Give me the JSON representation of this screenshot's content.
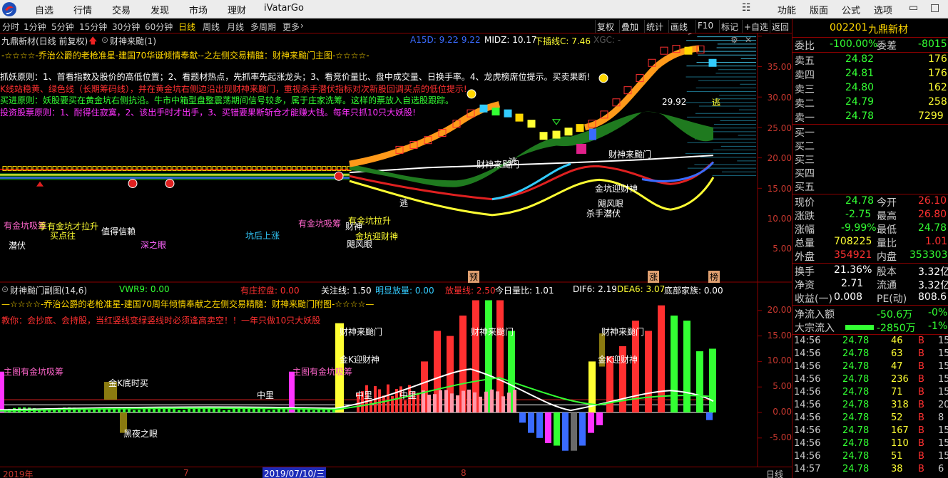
{
  "menu": {
    "items": [
      "自选",
      "行情",
      "交易",
      "发现",
      "市场",
      "理财",
      "iVatarGo"
    ],
    "right": [
      "功能",
      "版面",
      "公式",
      "选项"
    ]
  },
  "periods": [
    "分时",
    "1分钟",
    "5分钟",
    "15分钟",
    "30分钟",
    "60分钟",
    "日线",
    "周线",
    "月线",
    "多周期",
    "更多"
  ],
  "active_period": "日线",
  "tools": [
    "复权",
    "叠加",
    "统计",
    "画线",
    "F10",
    "标记",
    "+自选",
    "返回"
  ],
  "main": {
    "title": "九鼎新材(日线 前复权)",
    "indicator": "财神来颱(1)",
    "values": [
      {
        "t": "A15D: 9.22",
        "c": "#3a6bff"
      },
      {
        "t": ": 9.22",
        "c": "#3a6bff"
      },
      {
        "t": "MIDZ: 10.17",
        "c": "#ffffff"
      },
      {
        "t": "下插线C: 7.46",
        "c": "#ffff33"
      },
      {
        "t": "XGC: -",
        "c": "#555"
      }
    ],
    "banner": "-☆☆☆☆-乔治公爵的老枪准星-建国70华诞倾情奉献--之左侧交易精髓：财神来颱门主图-☆☆☆☆-",
    "desc": [
      {
        "t": "抓妖原则：1、首看指数及股价的高低位置；2、看题材热点，先抓率先起涨龙头；3、看竞价量比、盘中成交量、日换手率。4、龙虎榜席位提示。买卖果断!",
        "c": "#ffffff"
      },
      {
        "t": "K线站稳黄、绿色线（长期筹码线），并在黄金坑右侧边沿出现财神来颱门，重视杀手潜伏指标对次新股回调买点的低位提示!",
        "c": "#ff3030"
      },
      {
        "t": "买进原则：妖股要买在黄金坑右侧抗沿。牛市中箱型盘整震荡期间信号较多，属于庄家洗筹。这样的票放入自选股跟踪。",
        "c": "#33ff33"
      },
      {
        "t": "投资股票原则：1、耐得住寂寞，2、该出手时才出手，3、买错要果断斩仓才能赚大钱。每年只抓10只大妖股!",
        "c": "#ff33ff"
      }
    ],
    "price_ticks": [
      "35.00",
      "30.00",
      "25.00",
      "20.00",
      "15.00",
      "10.00",
      "5.00"
    ],
    "labels": [
      {
        "t": "有金坑吸筹",
        "c": "#ff66cc"
      },
      {
        "t": "季有金坑才拉升",
        "c": "#ffff33"
      },
      {
        "t": "买点往",
        "c": "#ffff33"
      },
      {
        "t": "值得信赖",
        "c": "#ffffff"
      },
      {
        "t": "潜伏",
        "c": "#ffffff"
      },
      {
        "t": "深之眼",
        "c": "#ff66ff"
      },
      {
        "t": "坑后上涨",
        "c": "#33ccff"
      },
      {
        "t": "有金坑吸筹",
        "c": "#ff66cc"
      },
      {
        "t": "有金坑拉升",
        "c": "#ffff33"
      },
      {
        "t": "财神",
        "c": "#ffffff"
      },
      {
        "t": "金坑迎财神",
        "c": "#ffff33"
      },
      {
        "t": "飓风眼",
        "c": "#ffffff"
      },
      {
        "t": "逃",
        "c": "#ffffff"
      },
      {
        "t": "财神来颱门",
        "c": "#ffffff"
      },
      {
        "t": "逃",
        "c": "#ffffff"
      },
      {
        "t": "财神来颱门",
        "c": "#ffffff"
      },
      {
        "t": "金坑迎财神",
        "c": "#ffffff"
      },
      {
        "t": "飓风眼",
        "c": "#ffffff"
      },
      {
        "t": "杀手潜伏",
        "c": "#ffffff"
      },
      {
        "t": "29.92",
        "c": "#ffffff"
      },
      {
        "t": "逃",
        "c": "#ffff33"
      },
      {
        "t": "预",
        "c": "#000000"
      },
      {
        "t": "涨",
        "c": "#000000"
      },
      {
        "t": "榜",
        "c": "#000000"
      }
    ]
  },
  "sub": {
    "title": "财神颱门副图(14,6)",
    "values": [
      {
        "t": "VWR9: 0.00",
        "c": "#33ff33"
      },
      {
        "t": "有庄控盘: 0.00",
        "c": "#ff3030"
      },
      {
        "t": "关注线: 1.50",
        "c": "#ffffff"
      },
      {
        "t": "明显放量: 0.00",
        "c": "#33ccff"
      },
      {
        "t": "放量线: 2.50",
        "c": "#ff3030"
      },
      {
        "t": "今日量比: 1.01",
        "c": "#ffffff"
      },
      {
        "t": "DIF6: 2.19",
        "c": "#ffffff"
      },
      {
        "t": "DEA6: 3.07",
        "c": "#ffff33"
      },
      {
        "t": "底部家族: 0.00",
        "c": "#ffffff"
      }
    ],
    "banner": "—☆☆☆☆-乔治公爵的老枪准星-建国70周年倾情奉献之左侧交易精髓：财神来颱门附图-☆☆☆☆—",
    "teach": "教你：会抄底、会持股，当红竖线变绿竖线时必须逢高卖空！！一年只做10只大妖股",
    "ticks": [
      "20.00",
      "15.00",
      "10.00",
      "5.00",
      "0.00",
      "-5.00"
    ],
    "labels": [
      {
        "t": "主图有金坑吸筹",
        "c": "#ff66cc"
      },
      {
        "t": "金K底时买",
        "c": "#ffffff"
      },
      {
        "t": "黑夜之眼",
        "c": "#ffffff"
      },
      {
        "t": "中里",
        "c": "#ffffff"
      },
      {
        "t": "主图有金坑吸筹",
        "c": "#ff66cc"
      },
      {
        "t": "财神来颱门",
        "c": "#ffffff"
      },
      {
        "t": "金K迎财神",
        "c": "#ffffff"
      },
      {
        "t": "中里",
        "c": "#ffffff"
      },
      {
        "t": "中里",
        "c": "#ffffff"
      },
      {
        "t": "财神来颱门",
        "c": "#ffffff"
      },
      {
        "t": "财神来颱门",
        "c": "#ffffff"
      },
      {
        "t": "金K迎财神",
        "c": "#ffffff"
      }
    ]
  },
  "dates": [
    {
      "t": "2019年",
      "hl": false
    },
    {
      "t": "7",
      "hl": false
    },
    {
      "t": "2019/07/10/三",
      "hl": true
    },
    {
      "t": "8",
      "hl": false
    }
  ],
  "corner_label": "日线",
  "stock": {
    "code": "002201",
    "name": "九鼎新材"
  },
  "order_book": [
    {
      "l": "委比",
      "v": "-100.00%",
      "c": "#33ff33",
      "l2": "委差",
      "v2": "-8015",
      "c2": "#33ff33"
    },
    {
      "l": "卖五",
      "v": "24.82",
      "c": "#33ff33",
      "q": "176"
    },
    {
      "l": "卖四",
      "v": "24.81",
      "c": "#33ff33",
      "q": "176"
    },
    {
      "l": "卖三",
      "v": "24.80",
      "c": "#33ff33",
      "q": "162"
    },
    {
      "l": "卖二",
      "v": "24.79",
      "c": "#33ff33",
      "q": "258"
    },
    {
      "l": "卖一",
      "v": "24.78",
      "c": "#33ff33",
      "q": "7299"
    },
    {
      "l": "买一",
      "v": "",
      "c": "#ccc",
      "q": ""
    },
    {
      "l": "买二",
      "v": "",
      "c": "#ccc",
      "q": ""
    },
    {
      "l": "买三",
      "v": "",
      "c": "#ccc",
      "q": ""
    },
    {
      "l": "买四",
      "v": "",
      "c": "#ccc",
      "q": ""
    },
    {
      "l": "买五",
      "v": "",
      "c": "#ccc",
      "q": ""
    }
  ],
  "quote": [
    {
      "l": "现价",
      "v": "24.78",
      "c": "#33ff33",
      "l2": "今开",
      "v2": "26.10",
      "c2": "#ff3030"
    },
    {
      "l": "涨跌",
      "v": "-2.75",
      "c": "#33ff33",
      "l2": "最高",
      "v2": "26.80",
      "c2": "#ff3030"
    },
    {
      "l": "涨幅",
      "v": "-9.99%",
      "c": "#33ff33",
      "l2": "最低",
      "v2": "24.78",
      "c2": "#33ff33"
    },
    {
      "l": "总量",
      "v": "708225",
      "c": "#ffff33",
      "l2": "量比",
      "v2": "1.01",
      "c2": "#ff3030"
    },
    {
      "l": "外盘",
      "v": "354921",
      "c": "#ff3030",
      "l2": "内盘",
      "v2": "353303",
      "c2": "#33ff33"
    }
  ],
  "stats": [
    {
      "l": "换手",
      "v": "21.36%",
      "c": "#ffffff",
      "l2": "股本",
      "v2": "3.32亿",
      "c2": "#ffffff"
    },
    {
      "l": "净资",
      "v": "2.71",
      "c": "#ffffff",
      "l2": "流通",
      "v2": "3.32亿",
      "c2": "#ffffff"
    },
    {
      "l": "收益(一)",
      "v": "0.008",
      "c": "#ffffff",
      "l2": "PE(动)",
      "v2": "808.6",
      "c2": "#ffffff"
    }
  ],
  "flows": [
    {
      "l": "净流入额",
      "v": "-50.6万",
      "p": "-0%"
    },
    {
      "l": "大宗流入",
      "v": "-2850万",
      "p": "-1%"
    }
  ],
  "ticks": [
    {
      "time": "14:56",
      "price": "24.78",
      "vol": "46",
      "side": "B",
      "n": "15"
    },
    {
      "time": "14:56",
      "price": "24.78",
      "vol": "63",
      "side": "B",
      "n": "15"
    },
    {
      "time": "14:56",
      "price": "24.78",
      "vol": "47",
      "side": "B",
      "n": "15"
    },
    {
      "time": "14:56",
      "price": "24.78",
      "vol": "236",
      "side": "B",
      "n": "15"
    },
    {
      "time": "14:56",
      "price": "24.78",
      "vol": "71",
      "side": "B",
      "n": "15"
    },
    {
      "time": "14:56",
      "price": "24.78",
      "vol": "318",
      "side": "B",
      "n": "20"
    },
    {
      "time": "14:56",
      "price": "24.78",
      "vol": "52",
      "side": "B",
      "n": "8"
    },
    {
      "time": "14:56",
      "price": "24.78",
      "vol": "167",
      "side": "B",
      "n": "15"
    },
    {
      "time": "14:56",
      "price": "24.78",
      "vol": "110",
      "side": "B",
      "n": "15"
    },
    {
      "time": "14:56",
      "price": "24.78",
      "vol": "51",
      "side": "B",
      "n": "15"
    },
    {
      "time": "14:57",
      "price": "24.78",
      "vol": "38",
      "side": "B",
      "n": "6"
    }
  ]
}
